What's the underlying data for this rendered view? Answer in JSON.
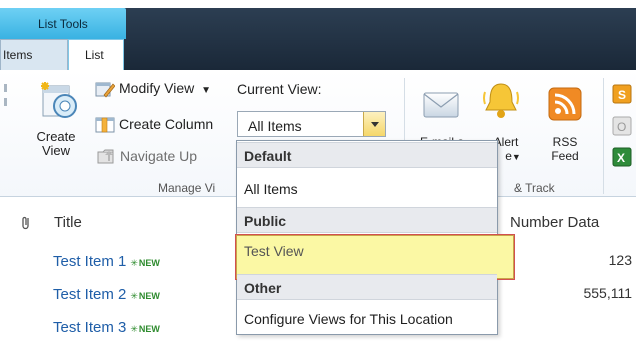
{
  "ribbon": {
    "context_tab": "List Tools",
    "tabs": [
      {
        "label": "Items"
      },
      {
        "label": "List"
      }
    ],
    "manage_views": {
      "create_view": "Create\nView",
      "modify_view": "Modify View",
      "create_column": "Create Column",
      "navigate_up": "Navigate Up",
      "current_view_label": "Current View:",
      "current_view_value": "All Items",
      "group_label": "Manage Vi"
    },
    "share_track": {
      "email_link": "E-mail a",
      "alert_me": "Alert",
      "alert_me_line2": "e",
      "rss_feed": "RSS",
      "rss_feed_line2": "Feed",
      "group_label": "& Track"
    }
  },
  "dropdown": {
    "sections": [
      {
        "header": "Default",
        "items": [
          "All Items"
        ]
      },
      {
        "header": "Public",
        "items": [
          "Test View"
        ]
      },
      {
        "header": "Other",
        "items": [
          "Configure Views for This Location"
        ]
      }
    ],
    "highlighted": "Test View"
  },
  "list": {
    "columns": {
      "title": "Title",
      "number": "Number Data"
    },
    "rows": [
      {
        "title": "Test Item 1",
        "badge": "NEW",
        "number": "123"
      },
      {
        "title": "Test Item 2",
        "badge": "NEW",
        "number": "555,111"
      },
      {
        "title": "Test Item 3",
        "badge": "NEW",
        "number": ""
      }
    ]
  },
  "colors": {
    "context_tab": "#39b2e2",
    "topbar": "#1a2838",
    "link": "#1f5ea8",
    "highlight": "#fbf8a4",
    "highlight_border": "#d25050"
  }
}
